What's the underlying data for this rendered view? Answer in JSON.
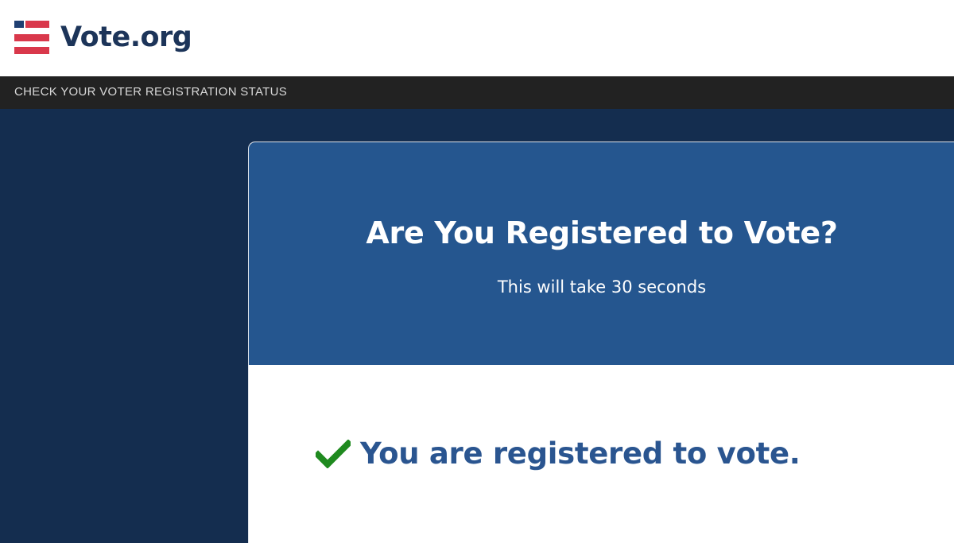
{
  "brand": {
    "name": "Vote.org",
    "icon": "flag-icon",
    "colors": {
      "red": "#d9384b",
      "navy": "#1f3f72",
      "text": "#1c3459"
    }
  },
  "subnav": {
    "label": "CHECK YOUR VOTER REGISTRATION STATUS"
  },
  "card": {
    "title": "Are You Registered to Vote?",
    "subtitle": "This will take 30 seconds",
    "header_color": "#25568f"
  },
  "result": {
    "icon": "checkmark-icon",
    "icon_color": "#1f8a1f",
    "message": "You are registered to vote."
  },
  "page": {
    "background": "#142d4f"
  }
}
